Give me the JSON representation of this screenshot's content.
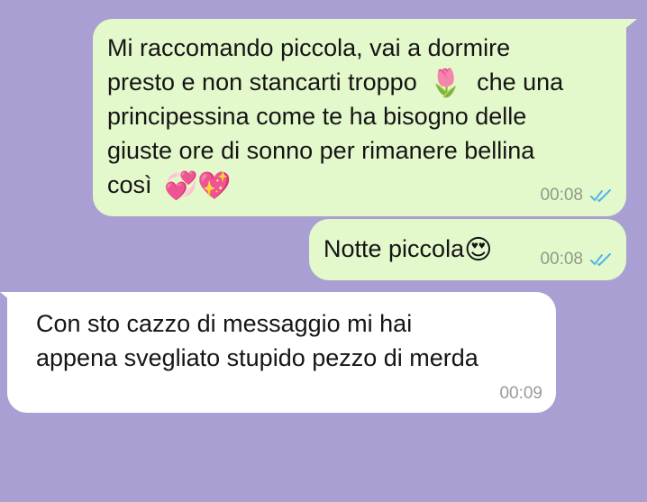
{
  "chat": {
    "messages": [
      {
        "direction": "outgoing",
        "lines": [
          "Mi raccomando piccola, vai a dormire",
          "presto e non stancarti troppo",
          "che una",
          "principessina come te ha bisogno delle",
          "giuste ore di sonno per rimanere bellina",
          "così"
        ],
        "emojis": [
          "🌷",
          "💞💖"
        ],
        "time": "00:08",
        "status_icon": "double-check-read-icon"
      },
      {
        "direction": "outgoing",
        "text": "Notte piccola",
        "emojis": [
          "😍"
        ],
        "time": "00:08",
        "status_icon": "double-check-read-icon"
      },
      {
        "direction": "incoming",
        "lines": [
          "Con sto cazzo di messaggio mi hai",
          "appena svegliato stupido pezzo di merda"
        ],
        "time": "00:09"
      }
    ]
  },
  "colors": {
    "background": "#a99fd2",
    "outgoing_bubble": "#e3f8cb",
    "incoming_bubble": "#ffffff",
    "read_ticks": "#4fb6ec",
    "timestamp": "#8f9a8d"
  }
}
